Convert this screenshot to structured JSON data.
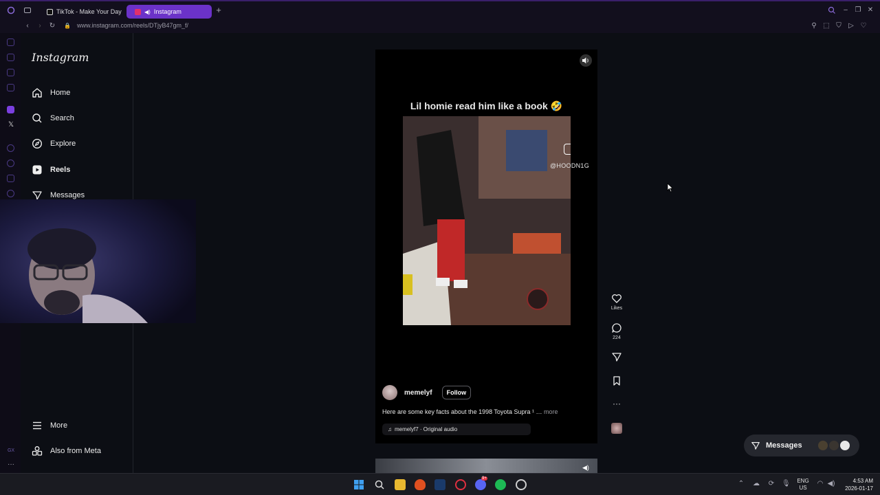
{
  "browser": {
    "tabs": [
      {
        "label": "TikTok - Make Your Day",
        "active": false
      },
      {
        "label": "Instagram",
        "active": true
      }
    ],
    "url": "www.instagram.com/reels/DTjyB47gm_f/"
  },
  "nav": {
    "logo": "Instagram",
    "items": [
      {
        "label": "Home",
        "icon": "home-icon"
      },
      {
        "label": "Search",
        "icon": "search-icon"
      },
      {
        "label": "Explore",
        "icon": "compass-icon"
      },
      {
        "label": "Reels",
        "icon": "reels-icon",
        "active": true
      },
      {
        "label": "Messages",
        "icon": "messages-icon"
      }
    ],
    "bottom": [
      {
        "label": "More",
        "icon": "menu-icon"
      },
      {
        "label": "Also from Meta",
        "icon": "meta-icon"
      }
    ]
  },
  "reel": {
    "caption_overlay": "Lil homie read him like a book 🤣",
    "watermark": "@HOODN1G",
    "username": "memelyf",
    "follow_label": "Follow",
    "description": "Here are some key facts about the 1998 Toyota Supra ¹ …",
    "more_label": "more",
    "audio": "memelyf7 · Original audio"
  },
  "actions": {
    "likes_label": "Likes",
    "comments_count": "224"
  },
  "messages_pill": {
    "label": "Messages"
  },
  "taskbar": {
    "lang": "ENG",
    "region": "US",
    "time": "4:53 AM",
    "date": "2026-01-17",
    "discord_badge": "9+"
  },
  "colors": {
    "accent": "#6b32c8",
    "background": "#0c0e14",
    "reel_bg": "#000000"
  }
}
